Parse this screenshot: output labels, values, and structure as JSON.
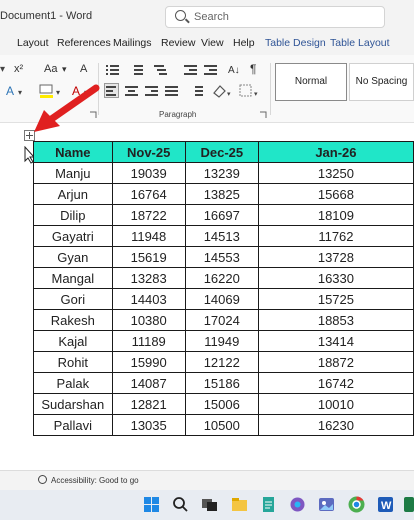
{
  "window": {
    "title": "Document1  -  Word"
  },
  "search": {
    "placeholder": "Search"
  },
  "ribbon_tabs": [
    "Layout",
    "References",
    "Mailings",
    "Review",
    "View",
    "Help",
    "Table Design",
    "Table Layout"
  ],
  "ribbon": {
    "paragraph_group_label": "Paragraph",
    "styles": {
      "normal": "Normal",
      "no_spacing": "No Spacing"
    }
  },
  "status": {
    "accessibility": "Accessibility: Good to go"
  },
  "table": {
    "headers": [
      "Name",
      "Nov-25",
      "Dec-25",
      "Jan-26"
    ],
    "rows": [
      [
        "Manju",
        "19039",
        "13239",
        "13250"
      ],
      [
        "Arjun",
        "16764",
        "13825",
        "15668"
      ],
      [
        "Dilip",
        "18722",
        "16697",
        "18109"
      ],
      [
        "Gayatri",
        "11948",
        "14513",
        "11762"
      ],
      [
        "Gyan",
        "15619",
        "14553",
        "13728"
      ],
      [
        "Mangal",
        "13283",
        "16220",
        "16330"
      ],
      [
        "Gori",
        "14403",
        "14069",
        "15725"
      ],
      [
        "Rakesh",
        "10380",
        "17024",
        "18853"
      ],
      [
        "Kajal",
        "11189",
        "11949",
        "13414"
      ],
      [
        "Rohit",
        "15990",
        "12122",
        "18872"
      ],
      [
        "Palak",
        "14087",
        "15186",
        "16742"
      ],
      [
        "Sudarshan",
        "12821",
        "15006",
        "10010"
      ],
      [
        "Pallavi",
        "13035",
        "10500",
        "16230"
      ]
    ]
  },
  "colors": {
    "header_fill": "#20e6c8",
    "arrow": "#e02020",
    "context_tab": "#2f5496"
  },
  "icons": [
    "search-icon",
    "table-move-handle-icon",
    "red-arrow-icon",
    "accessibility-icon"
  ]
}
